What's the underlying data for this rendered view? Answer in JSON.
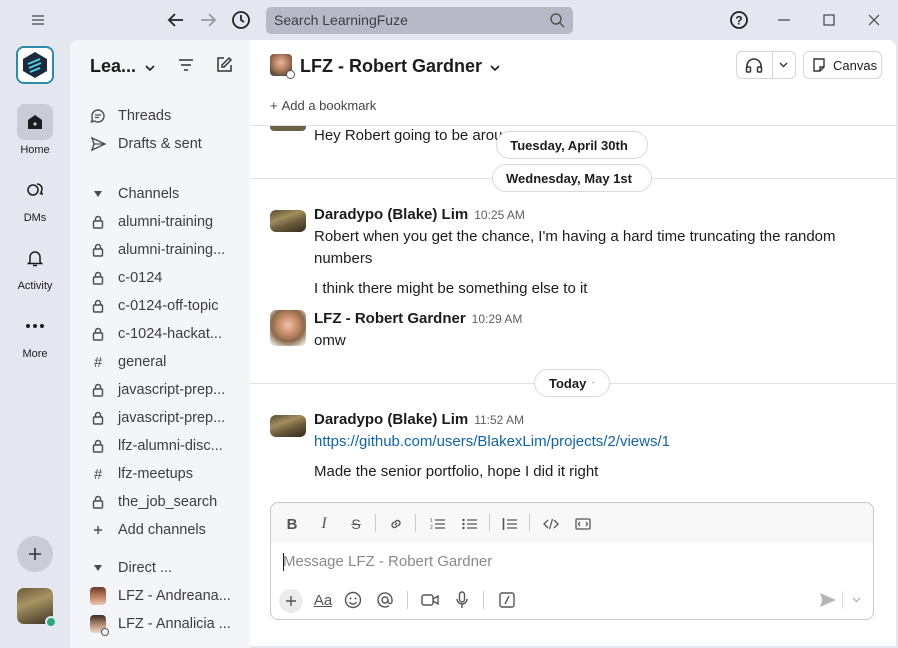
{
  "search": {
    "placeholder": "Search LearningFuze"
  },
  "rail": {
    "items": [
      {
        "label": "Home"
      },
      {
        "label": "DMs"
      },
      {
        "label": "Activity"
      },
      {
        "label": "More"
      }
    ]
  },
  "sidebar": {
    "workspace_name": "Lea...",
    "threads_label": "Threads",
    "drafts_label": "Drafts & sent",
    "channels_header": "Channels",
    "channels": [
      {
        "name": "alumni-training",
        "icon": "lock"
      },
      {
        "name": "alumni-training...",
        "icon": "lock"
      },
      {
        "name": "c-0124",
        "icon": "lock"
      },
      {
        "name": "c-0124-off-topic",
        "icon": "lock"
      },
      {
        "name": "c-1024-hackat...",
        "icon": "lock"
      },
      {
        "name": "general",
        "icon": "hash"
      },
      {
        "name": "javascript-prep...",
        "icon": "lock"
      },
      {
        "name": "javascript-prep...",
        "icon": "lock"
      },
      {
        "name": "lfz-alumni-disc...",
        "icon": "lock"
      },
      {
        "name": "lfz-meetups",
        "icon": "hash"
      },
      {
        "name": "the_job_search",
        "icon": "lock"
      }
    ],
    "add_channels_label": "Add channels",
    "dm_header": "Direct ...",
    "dms": [
      {
        "name": "LFZ - Andreana..."
      },
      {
        "name": "LFZ - Annalicia ..."
      }
    ]
  },
  "channel": {
    "title": "LFZ - Robert Gardner",
    "canvas_label": "Canvas",
    "bookmark_label": "Add a bookmark"
  },
  "messages": {
    "partial_text": "Hey Robert going to be arou",
    "date1": "Tuesday, April 30th",
    "date2": "Wednesday, May 1st",
    "m1": {
      "author": "Daradypo (Blake) Lim",
      "time": "10:25 AM",
      "text1": "Robert when you get the chance, I'm having a hard time truncating the random numbers",
      "text2": "I think there might be something else to it"
    },
    "m2": {
      "author": "LFZ - Robert Gardner",
      "time": "10:29 AM",
      "text": "omw"
    },
    "date3": "Today",
    "m3": {
      "author": "Daradypo (Blake) Lim",
      "time": "11:52 AM",
      "link": "https://github.com/users/BlakexLim/projects/2/views/1",
      "text": "Made the senior portfolio, hope I did it right"
    }
  },
  "composer": {
    "placeholder": "Message LFZ - Robert Gardner"
  },
  "colors": {
    "chrome": "#e4e6f0",
    "sidebar": "#f4f5f8",
    "link": "#1264a3",
    "presence": "#2bac76"
  }
}
